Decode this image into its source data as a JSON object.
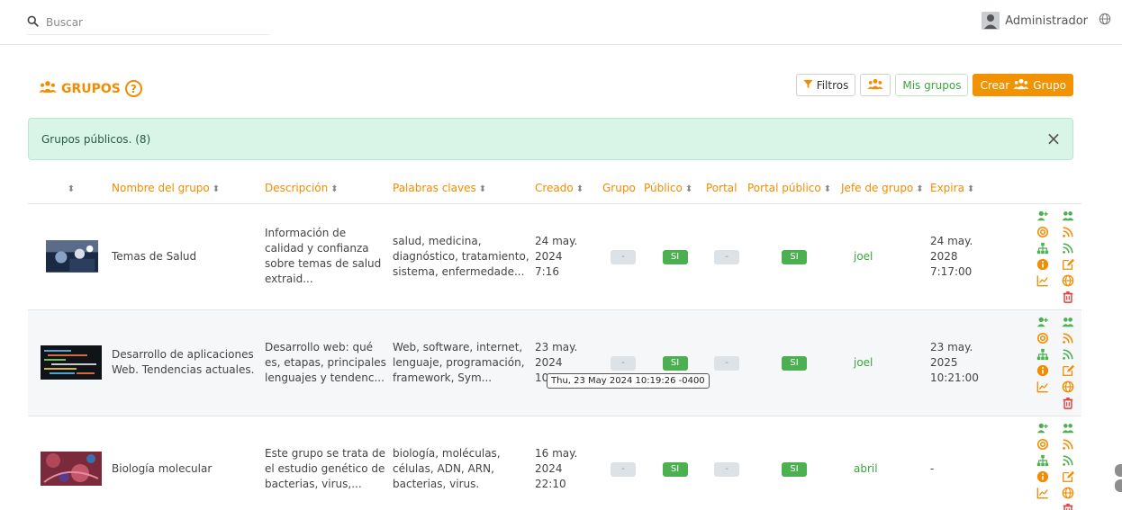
{
  "search": {
    "placeholder": "Buscar"
  },
  "user": {
    "name": "Administrador"
  },
  "page": {
    "title": "GRUPOS",
    "help": "?"
  },
  "toolbar": {
    "filters": "Filtros",
    "my_groups": "Mis grupos",
    "create_prefix": "Crear",
    "create_suffix": "Grupo"
  },
  "alert": {
    "text": "Grupos públicos. (8)",
    "close": "×"
  },
  "table": {
    "headers": [
      "Nombre del grupo",
      "Descripción",
      "Palabras claves",
      "Creado",
      "Grupo",
      "Público",
      "Portal",
      "Portal público",
      "Jefe de grupo",
      "Expira"
    ],
    "sort_icon": "⬍",
    "rows": [
      {
        "name": "Temas de Salud",
        "description": "Información de calidad y confianza sobre temas de salud extraid...",
        "keywords": "salud, medicina, diagnóstico, tratamiento, sistema, enfermedade...",
        "created": "24 may. 2024 7:16",
        "group": "-",
        "public": "SI",
        "portal": "-",
        "public_portal": "SI",
        "leader": "joel",
        "expires": "24 may. 2028 7:17:00"
      },
      {
        "name": "Desarrollo de aplicaciones Web. Tendencias actuales.",
        "description": "Desarrollo web: qué es, etapas, principales lenguajes y tendenc...",
        "keywords": "Web, software, internet, lenguaje, programación, framework, Sym...",
        "created": "23 may. 2024 10:19",
        "group": "-",
        "public": "SI",
        "portal": "-",
        "public_portal": "SI",
        "leader": "joel",
        "expires": "23 may. 2025 10:21:00"
      },
      {
        "name": "Biología molecular",
        "description": "Este grupo se trata de el estudio genético de bacterias, virus,...",
        "keywords": "biología, moléculas, células, ADN, ARN, bacterias, virus.",
        "created": "16 may. 2024 22:10",
        "group": "-",
        "public": "SI",
        "portal": "-",
        "public_portal": "SI",
        "leader": "abril",
        "expires": "-"
      }
    ]
  },
  "tooltip": {
    "text": "Thu, 23 May 2024 10:19:26 -0400"
  },
  "colors": {
    "accent": "#f28c00",
    "success": "#4caf50",
    "link": "#3aa63a",
    "danger": "#e53935"
  },
  "row_action_icons": [
    "add-member-icon",
    "members-icon",
    "target-icon",
    "rss-icon",
    "hierarchy-icon",
    "feed-icon",
    "info-icon",
    "edit-icon",
    "chart-icon",
    "globe-icon",
    "delete-icon"
  ]
}
